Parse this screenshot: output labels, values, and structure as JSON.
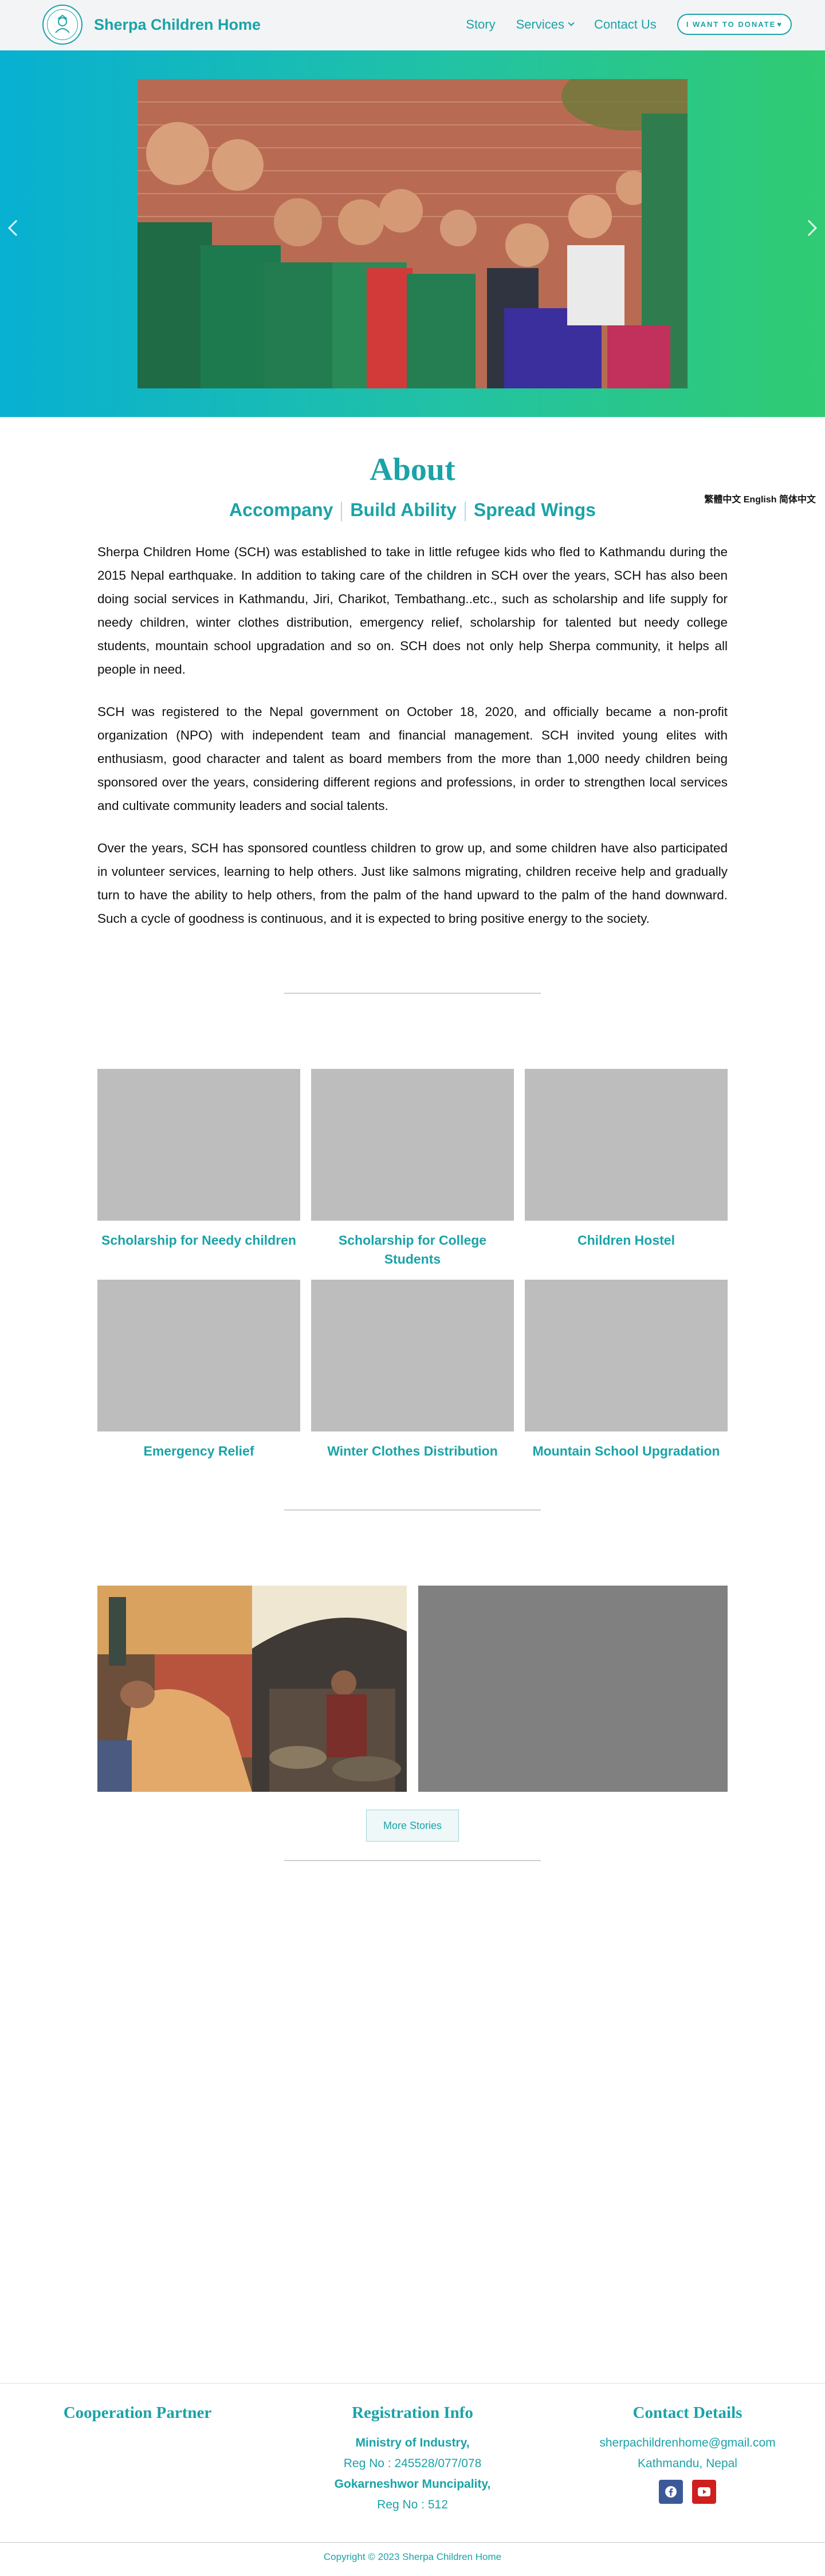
{
  "header": {
    "site_title": "Sherpa Children Home",
    "logo_icon": "sherpa-children-home-logo",
    "nav": {
      "story": "Story",
      "services": "Services",
      "contact": "Contact Us",
      "donate": "I WANT TO DONATE"
    }
  },
  "hero": {
    "prev_icon": "chevron-left-icon",
    "next_icon": "chevron-right-icon"
  },
  "about": {
    "title": "About",
    "taglines": [
      "Accompany",
      "Build Ability",
      "Spread Wings"
    ],
    "language_switcher": "繁體中文 English 简体中文",
    "paragraphs": [
      "Sherpa Children Home (SCH) was established to take in little refugee kids who fled to Kathmandu during the 2015 Nepal earthquake. In addition to taking care of the children in SCH over the years, SCH has also been doing social services in Kathmandu, Jiri, Charikot, Tembathang..etc., such as scholarship and life supply for needy children, winter clothes distribution, emergency relief, scholarship for talented but needy college students, mountain school upgradation and so on. SCH does not only help Sherpa community, it helps all people in need.",
      "SCH was registered to the Nepal government on October 18, 2020, and officially became a non-profit organization (NPO) with independent team and financial management. SCH invited young elites with enthusiasm, good character and talent as board members from the more than 1,000 needy children being sponsored over the years, considering different regions and professions, in order to strengthen local services and cultivate community leaders and social talents.",
      "Over the years, SCH has sponsored countless children to grow up, and some children have also participated in volunteer services, learning to help others. Just like salmons migrating, children receive help and gradually turn to have the ability to help others, from the palm of the hand upward to the palm of the hand downward. Such a cycle of goodness is continuous, and it is expected to bring positive energy to the society."
    ]
  },
  "services": [
    {
      "label": "Scholarship for Needy children"
    },
    {
      "label": "Scholarship for College Students"
    },
    {
      "label": "Children Hostel"
    },
    {
      "label": "Emergency Relief"
    },
    {
      "label": "Winter Clothes Distribution"
    },
    {
      "label": "Mountain School Upgradation"
    }
  ],
  "stories": {
    "more_button": "More Stories"
  },
  "footer": {
    "partner_heading": "Cooperation Partner",
    "registration_heading": "Registration Info",
    "registration_lines": [
      "Ministry of Industry,",
      "Reg No : 245528/077/078",
      "Gokarneshwor Muncipality,",
      "Reg No : 512"
    ],
    "contact_heading": "Contact Details",
    "email": "sherpachildrenhome@gmail.com",
    "location": "Kathmandu, Nepal",
    "facebook_icon": "facebook-icon",
    "youtube_icon": "youtube-icon",
    "facebook_color": "#3b5998",
    "youtube_color": "#cd201f",
    "copyright": "Copyright © 2023 Sherpa Children Home"
  }
}
